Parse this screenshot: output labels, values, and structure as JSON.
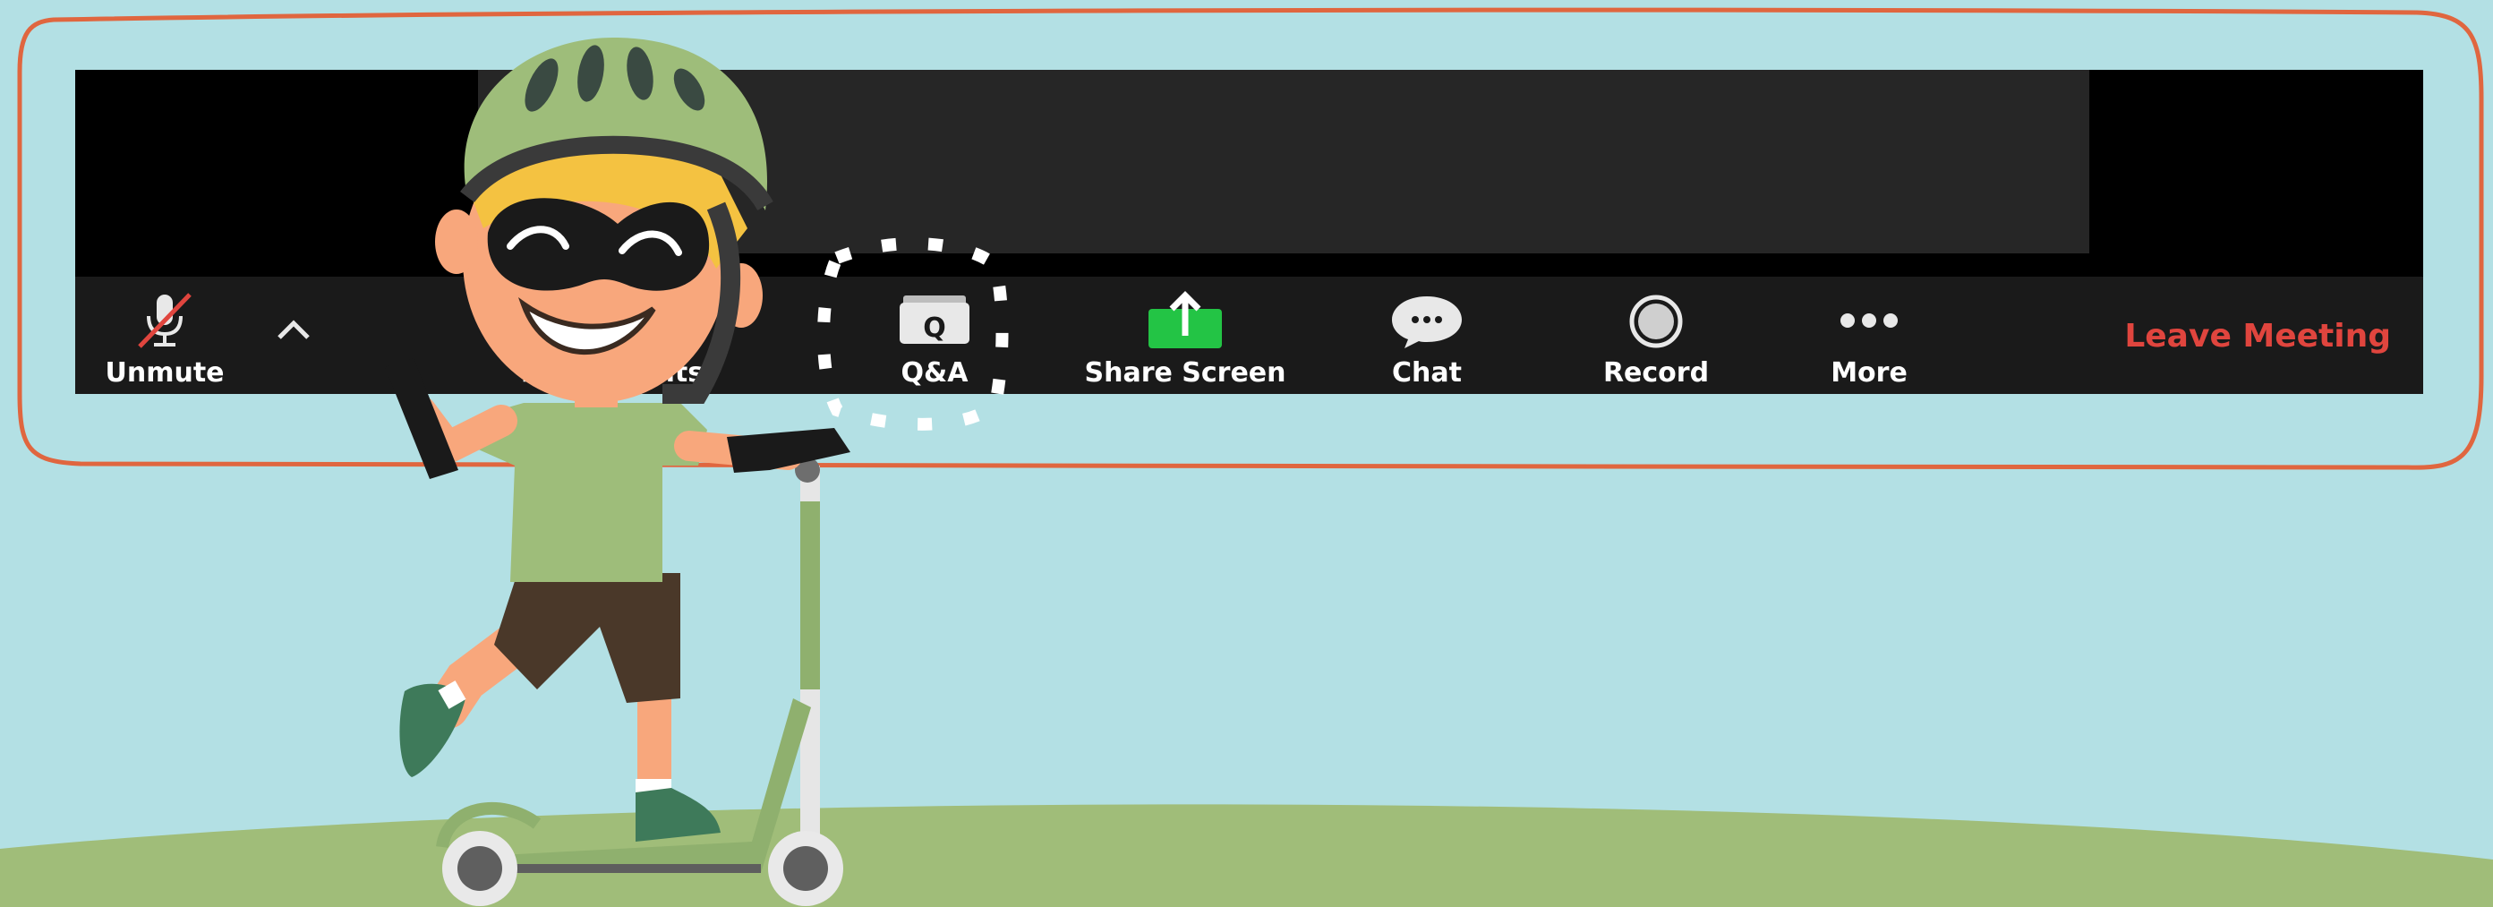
{
  "toolbar": {
    "unmute_label": "Unmute",
    "participants_label": "Participants",
    "qa_label": "Q&A",
    "share_label": "Share Screen",
    "chat_label": "Chat",
    "record_label": "Record",
    "more_label": "More",
    "leave_label": "Leave Meeting"
  },
  "colors": {
    "background": "#b3e0e4",
    "frame_outline": "#e0663f",
    "hill": "#a0bd79",
    "share_green": "#23c445",
    "leave_red": "#e0453e"
  },
  "icons": {
    "unmute": "muted-mic-icon",
    "caret": "chevron-up-icon",
    "qa": "qa-icon",
    "share": "share-screen-icon",
    "chat": "chat-bubble-icon",
    "record": "record-icon",
    "more": "more-dots-icon"
  }
}
